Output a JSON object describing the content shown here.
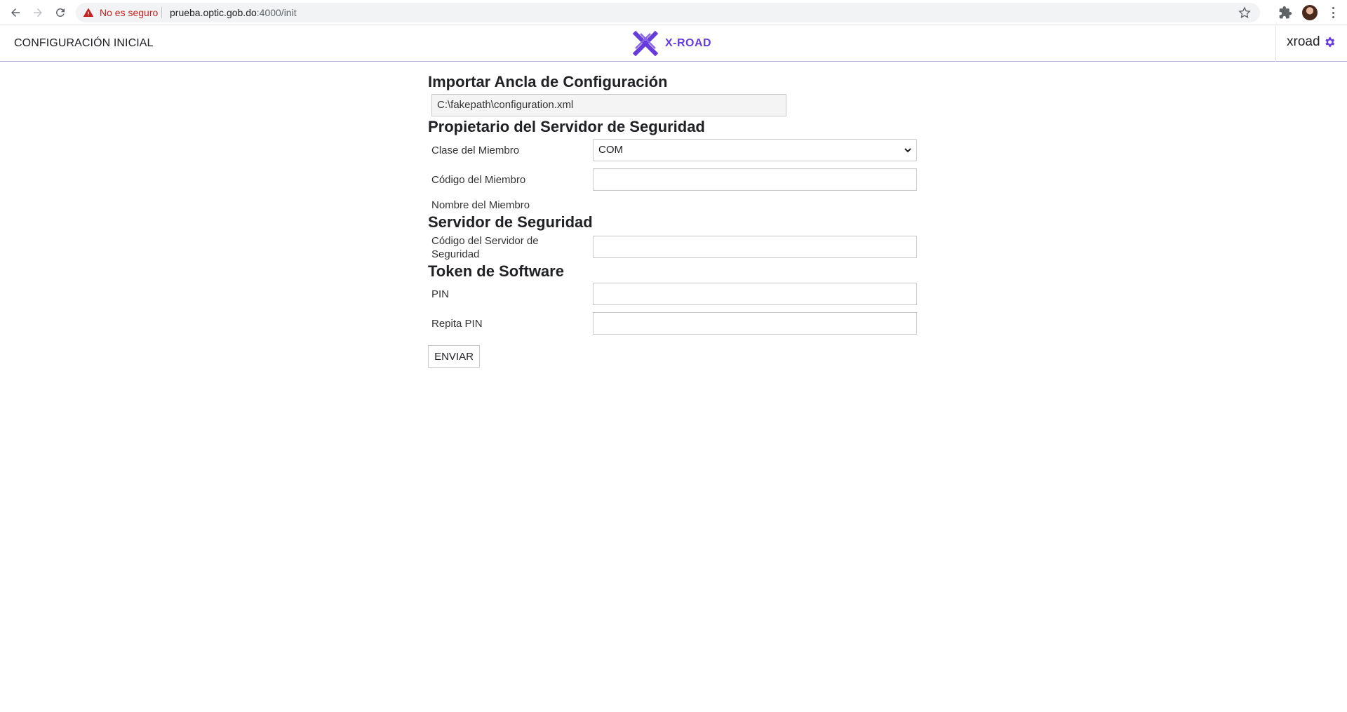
{
  "browser": {
    "security_text": "No es seguro",
    "url_host": "prueba.optic.gob.do",
    "url_path": ":4000/init"
  },
  "header": {
    "title": "CONFIGURACIÓN INICIAL",
    "logo_text": "X-ROAD",
    "user": "xroad",
    "brand_color": "#663cdc"
  },
  "anchor": {
    "title": "Importar Ancla de Configuración",
    "file_value": "C:\\fakepath\\configuration.xml"
  },
  "owner": {
    "title": "Propietario del Servidor de Seguridad",
    "member_class_label": "Clase del Miembro",
    "member_class_value": "COM",
    "member_code_label": "Código del Miembro",
    "member_code_value": "",
    "member_name_label": "Nombre del Miembro"
  },
  "server": {
    "title": "Servidor de Seguridad",
    "code_label": "Código del Servidor de Seguridad",
    "code_value": ""
  },
  "token": {
    "title": "Token de Software",
    "pin_label": "PIN",
    "pin_value": "",
    "repeat_pin_label": "Repita PIN",
    "repeat_pin_value": ""
  },
  "submit_label": "ENVIAR",
  "icons": [
    "back-arrow-icon",
    "forward-arrow-icon",
    "reload-icon",
    "warning-icon",
    "star-icon",
    "extensions-icon",
    "gear-icon",
    "chevron-down-icon",
    "xroad-logo-icon"
  ]
}
